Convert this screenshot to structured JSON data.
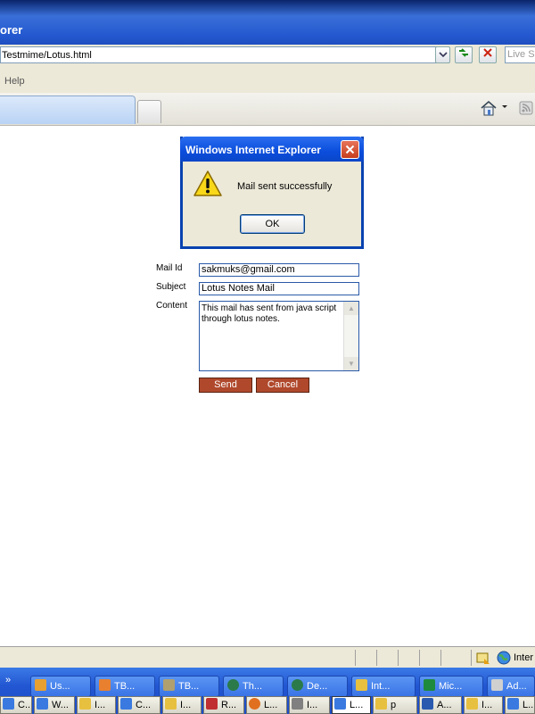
{
  "window": {
    "title": "orer"
  },
  "address": {
    "url": "Testmime/Lotus.html",
    "search_placeholder": "Live Se"
  },
  "menu": {
    "help": "Help"
  },
  "dialog": {
    "title": "Windows Internet Explorer",
    "message": "Mail sent successfully",
    "ok_label": "OK"
  },
  "form": {
    "mail_id_label": "Mail Id",
    "mail_id_value": "sakmuks@gmail.com",
    "subject_label": "Subject",
    "subject_value": "Lotus Notes Mail",
    "content_label": "Content",
    "content_value": "This mail has sent from java script through lotus notes.",
    "send_label": "Send",
    "cancel_label": "Cancel"
  },
  "status": {
    "zone": "Inter"
  },
  "taskbar": {
    "row1": [
      "Us...",
      "TB...",
      "TB...",
      "Th...",
      "De...",
      "Int...",
      "Mic...",
      "Ad..."
    ],
    "row2": [
      "C...",
      "W...",
      "I...",
      "C...",
      "I...",
      "R...",
      "L...",
      "I...",
      "L...",
      "p",
      "A...",
      "I...",
      "L..."
    ]
  }
}
